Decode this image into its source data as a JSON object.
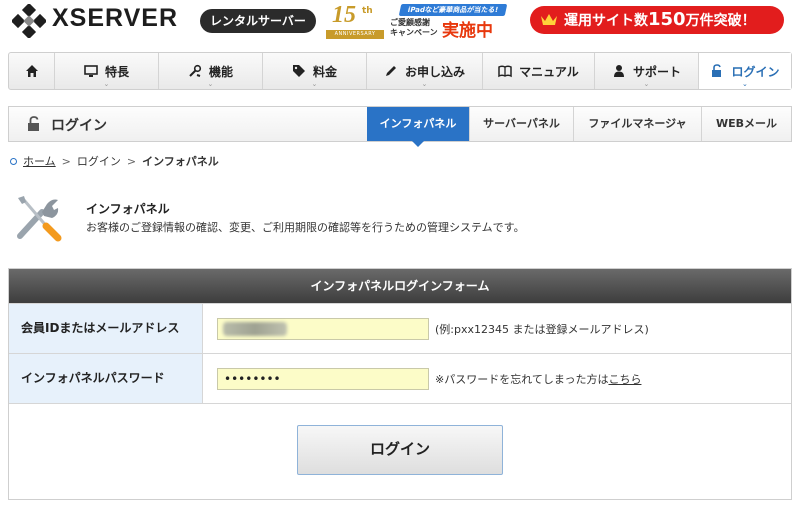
{
  "header": {
    "logo_text": "XSERVER",
    "logo_tag": "レンタルサーバー",
    "anniversary": {
      "number": "15",
      "suffix": "th",
      "label": "ANNIVERSARY"
    },
    "campaign": {
      "ribbon": "iPadなど豪華商品が当たる!",
      "left_line1": "ご愛顧感謝",
      "left_line2": "キャンペーン",
      "right": "実施中"
    },
    "stat": {
      "pre": "運用サイト数",
      "num": "150",
      "post": "万件突破！"
    }
  },
  "nav": {
    "items": [
      {
        "label": "",
        "icon": "home-icon"
      },
      {
        "label": "特長",
        "icon": "monitor-icon"
      },
      {
        "label": "機能",
        "icon": "tools-icon"
      },
      {
        "label": "料金",
        "icon": "tag-icon"
      },
      {
        "label": "お申し込み",
        "icon": "pencil-icon"
      },
      {
        "label": "マニュアル",
        "icon": "book-icon"
      },
      {
        "label": "サポート",
        "icon": "person-icon"
      },
      {
        "label": "ログイン",
        "icon": "unlock-icon"
      }
    ]
  },
  "section": {
    "title": "ログイン",
    "tabs": [
      "インフォパネル",
      "サーバーパネル",
      "ファイルマネージャ",
      "WEBメール"
    ]
  },
  "breadcrumb": {
    "home": "ホーム",
    "login": "ログイン",
    "current": "インフォパネル",
    "sep": ">"
  },
  "intro": {
    "title": "インフォパネル",
    "description": "お客様のご登録情報の確認、変更、ご利用期限の確認等を行うための管理システムです。"
  },
  "form": {
    "heading": "インフォパネルログインフォーム",
    "id_label": "会員IDまたはメールアドレス",
    "id_value": "",
    "id_hint": "(例:pxx12345 または登録メールアドレス)",
    "password_label": "インフォパネルパスワード",
    "password_value": "••••••••",
    "password_hint": "※パスワードを忘れてしまった方は",
    "password_link": "こちら",
    "submit_label": "ログイン"
  },
  "colors": {
    "accent": "#2a73c6",
    "badge": "#e21d1d",
    "input_bg": "#fcfcc8",
    "label_bg": "#e7f1fb"
  }
}
